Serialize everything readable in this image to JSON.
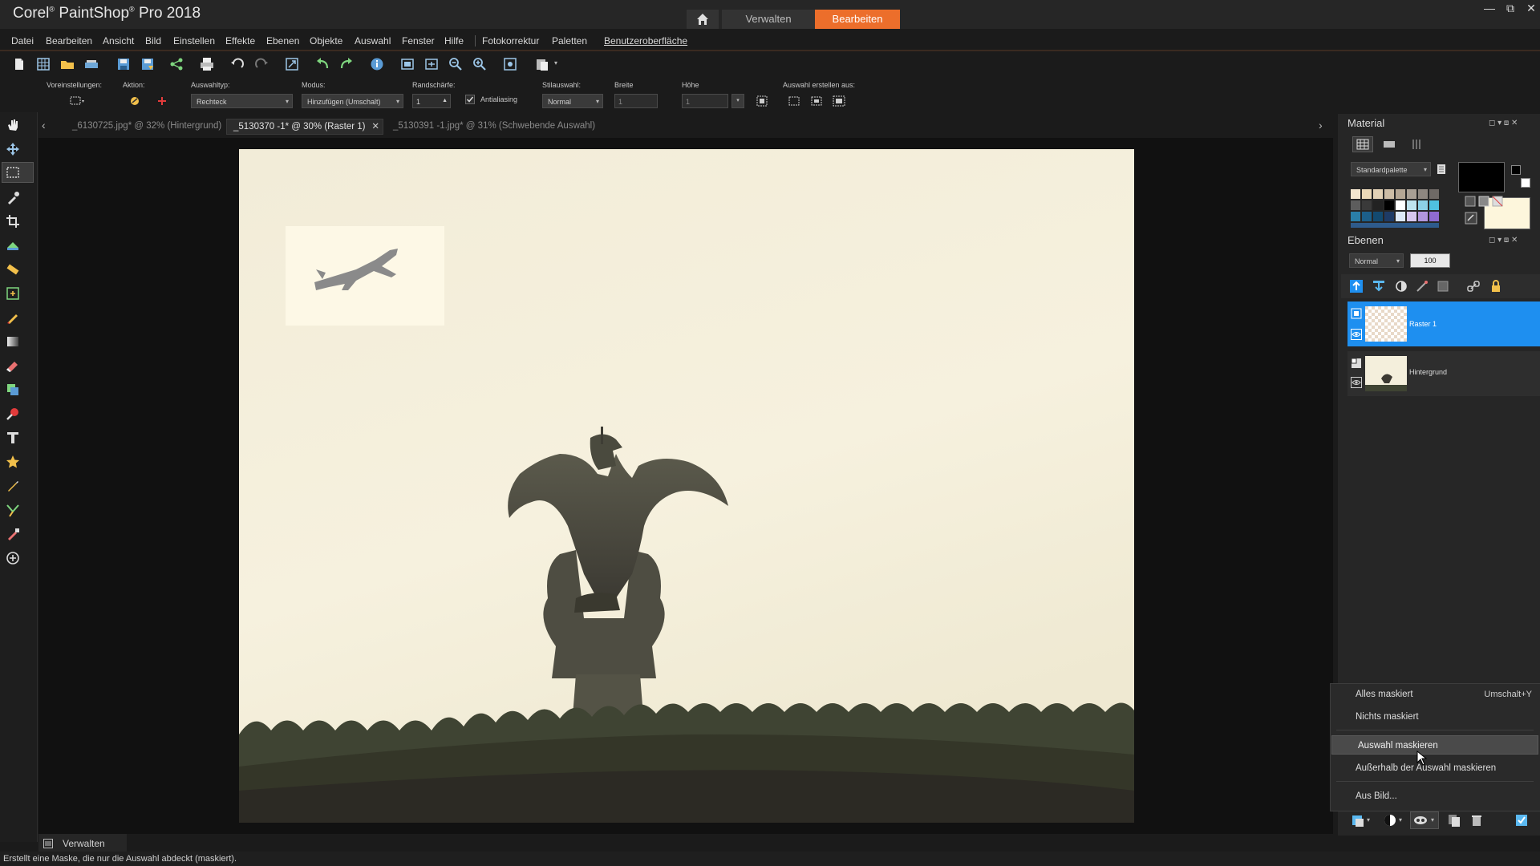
{
  "app": {
    "title": "Corel PaintShop Pro 2018",
    "brand_first": "Corel",
    "brand_rest": "PaintShop",
    "brand_mark": "®",
    "brand_tail": "Pro 2018"
  },
  "workspace_tabs": {
    "manage": "Verwalten",
    "edit": "Bearbeiten"
  },
  "colors": {
    "accent": "#ec6e2b",
    "selection_blue": "#1e8ff0",
    "background": "#1b1b1b",
    "panel": "#262626"
  },
  "menu": [
    "Datei",
    "Bearbeiten",
    "Ansicht",
    "Bild",
    "Einstellen",
    "Effekte",
    "Ebenen",
    "Objekte",
    "Auswahl",
    "Fenster",
    "Hilfe",
    "Fotokorrektur",
    "Paletten",
    "Benutzeroberfläche"
  ],
  "options": {
    "presets_label": "Voreinstellungen:",
    "action_label": "Aktion:",
    "selection_type_label": "Auswahltyp:",
    "selection_type_value": "Rechteck",
    "mode_label": "Modus:",
    "mode_value": "Hinzufügen (Umschalt)",
    "feather_label": "Randschärfe:",
    "feather_value": "1",
    "antialias_label": "Antialiasing",
    "style_label": "Stilauswahl:",
    "style_value": "Normal",
    "width_label": "Breite",
    "width_value": "1",
    "height_label": "Höhe",
    "height_value": "1",
    "create_from_label": "Auswahl erstellen aus:"
  },
  "doc_tabs": [
    {
      "label": "_6130725.jpg* @  32% (Hintergrund)"
    },
    {
      "label": "_5130370 -1* @  30% (Raster 1)"
    },
    {
      "label": "_5130391 -1.jpg* @  31% (Schwebende Auswahl)"
    }
  ],
  "material_panel": {
    "title": "Material",
    "palette_value": "Standardpalette"
  },
  "layers_panel": {
    "title": "Ebenen",
    "blend_mode": "Normal",
    "opacity": "100",
    "layers": [
      {
        "name": "Raster 1",
        "selected": true
      },
      {
        "name": "Hintergrund",
        "selected": false
      }
    ]
  },
  "context_menu": {
    "items": [
      {
        "label": "Alles maskiert",
        "shortcut": "Umschalt+Y"
      },
      {
        "label": "Nichts maskiert",
        "shortcut": ""
      },
      {
        "label": "Auswahl maskieren",
        "shortcut": "",
        "highlighted": true
      },
      {
        "label": "Außerhalb der Auswahl maskieren",
        "shortcut": ""
      },
      {
        "label": "Aus Bild...",
        "shortcut": ""
      }
    ]
  },
  "bottom_tab": "Verwalten",
  "status_text": "Erstellt eine Maske, die nur die Auswahl abdeckt (maskiert).",
  "icons": {
    "tools": [
      "pan-icon",
      "move-icon",
      "selection-icon",
      "dropper-icon",
      "crop-icon",
      "straighten-icon",
      "ruler-icon",
      "text-cursor-icon",
      "paint-brush-icon",
      "gradient-icon",
      "eraser-icon",
      "clone-icon",
      "red-eye-icon",
      "text-tool-icon",
      "shape-star-icon",
      "pen-icon",
      "pen-tool-icon",
      "color-replace-icon",
      "add-tool-icon"
    ]
  }
}
